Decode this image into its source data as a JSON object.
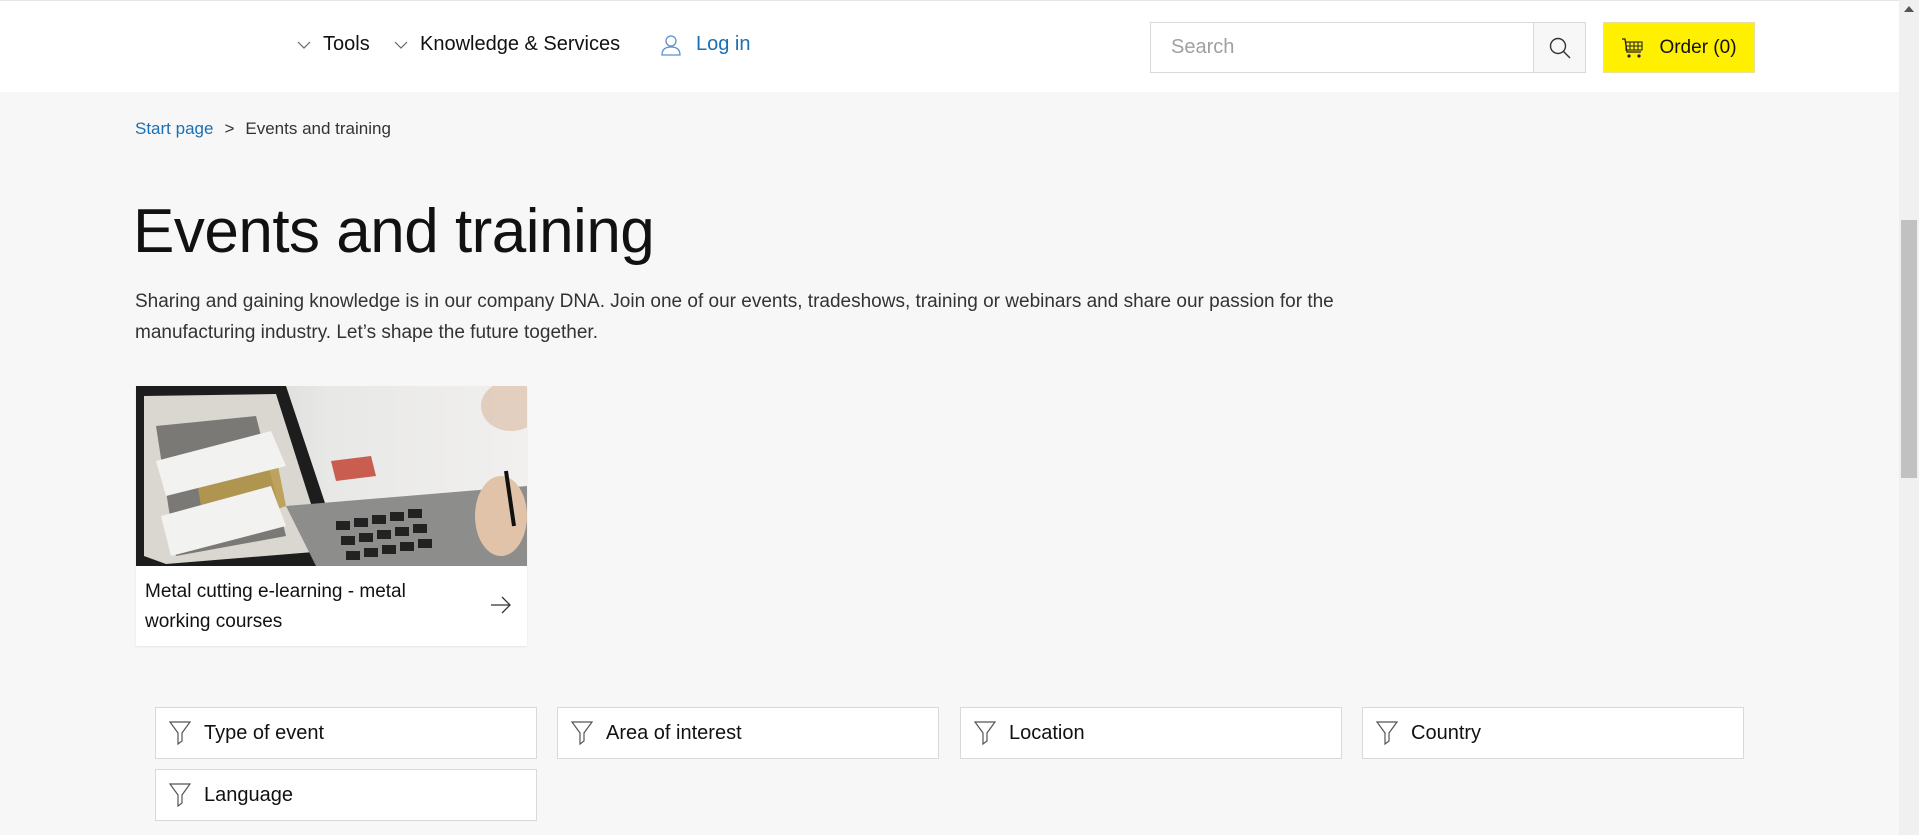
{
  "header": {
    "nav": [
      {
        "label": "Tools",
        "icon": "chevron-down-icon"
      },
      {
        "label": "Knowledge & Services",
        "icon": "chevron-down-icon"
      }
    ],
    "login_label": "Log in",
    "search_placeholder": "Search",
    "search_value": "",
    "order_label": "Order (0)"
  },
  "breadcrumb": {
    "items": [
      "Start page",
      "Events and training"
    ],
    "separator": ">"
  },
  "page": {
    "title": "Events and training",
    "intro": "Sharing and gaining knowledge is in our company DNA. Join one of our events, tradeshows, training or webinars and share our passion for the manufacturing industry. Let’s shape the future together."
  },
  "cards": [
    {
      "title": "Metal cutting e-learning - metal working courses",
      "image": "laptop-e-learning-photo"
    }
  ],
  "filters": [
    {
      "label": "Type of event"
    },
    {
      "label": "Area of interest"
    },
    {
      "label": "Location"
    },
    {
      "label": "Country"
    },
    {
      "label": "Language"
    }
  ],
  "colors": {
    "accent_link": "#1a6fb5",
    "order_button": "#fff000",
    "page_background": "#f7f7f7"
  }
}
